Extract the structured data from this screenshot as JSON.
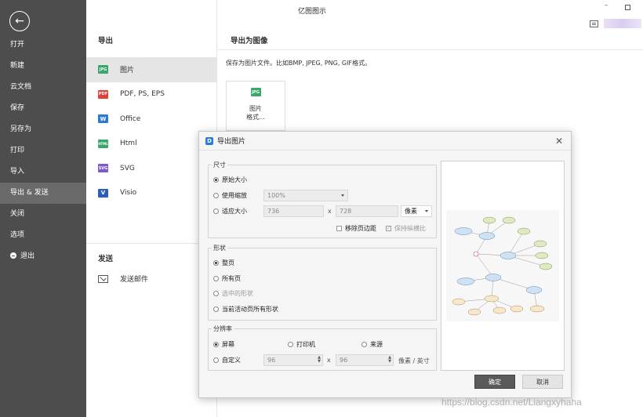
{
  "app": {
    "title": "亿图图示"
  },
  "colors": {
    "sidebar_bg": "#4d4d4d",
    "jpg": "#3aa86b",
    "pdf": "#e0413a",
    "office": "#2a7bd3",
    "html": "#3aa86b",
    "svg": "#7d5bc9",
    "visio": "#2a5fb8"
  },
  "sidebar": {
    "items": [
      {
        "label": "打开"
      },
      {
        "label": "新建"
      },
      {
        "label": "云文档"
      },
      {
        "label": "保存"
      },
      {
        "label": "另存为"
      },
      {
        "label": "打印"
      },
      {
        "label": "导入"
      },
      {
        "label": "导出 & 发送"
      },
      {
        "label": "关闭"
      },
      {
        "label": "选项"
      },
      {
        "label": "退出"
      }
    ]
  },
  "export": {
    "heading": "导出",
    "items": [
      {
        "label": "图片",
        "badge": "JPG",
        "icon": "jpg-file-icon"
      },
      {
        "label": "PDF, PS, EPS",
        "badge": "PDF",
        "icon": "pdf-file-icon"
      },
      {
        "label": "Office",
        "badge": "W",
        "icon": "office-file-icon"
      },
      {
        "label": "Html",
        "badge": "HTML",
        "icon": "html-file-icon"
      },
      {
        "label": "SVG",
        "badge": "SVG",
        "icon": "svg-file-icon"
      },
      {
        "label": "Visio",
        "badge": "V",
        "icon": "visio-file-icon"
      }
    ],
    "send_heading": "发送",
    "send_item": "发送邮件"
  },
  "main": {
    "heading": "导出为图像",
    "description": "保存为图片文件。比如BMP, JPEG, PNG, GIF格式。",
    "card_badge": "JPG",
    "card_line1": "图片",
    "card_line2": "格式..."
  },
  "dialog": {
    "title": "导出图片",
    "size": {
      "legend": "尺寸",
      "original": "原始大小",
      "use_scale": "使用缩放",
      "scale_value": "100%",
      "fit_size": "适应大小",
      "width": "736",
      "height": "728",
      "x": "x",
      "unit": "像素",
      "remove_margin": "移除页边距",
      "keep_ratio": "保持纵横比"
    },
    "shape": {
      "legend": "形状",
      "whole_page": "整页",
      "all_pages": "所有页",
      "selected": "选中的形状",
      "current_page_all": "当前活动页所有形状"
    },
    "resolution": {
      "legend": "分辨率",
      "screen": "屏幕",
      "printer": "打印机",
      "source": "来源",
      "custom": "自定义",
      "res_x": "96",
      "res_y": "96",
      "x": "x",
      "unit": "像素 / 英寸"
    },
    "ok": "确定",
    "cancel": "取消"
  },
  "watermark": "https://blog.csdn.net/Liangxyhaha"
}
